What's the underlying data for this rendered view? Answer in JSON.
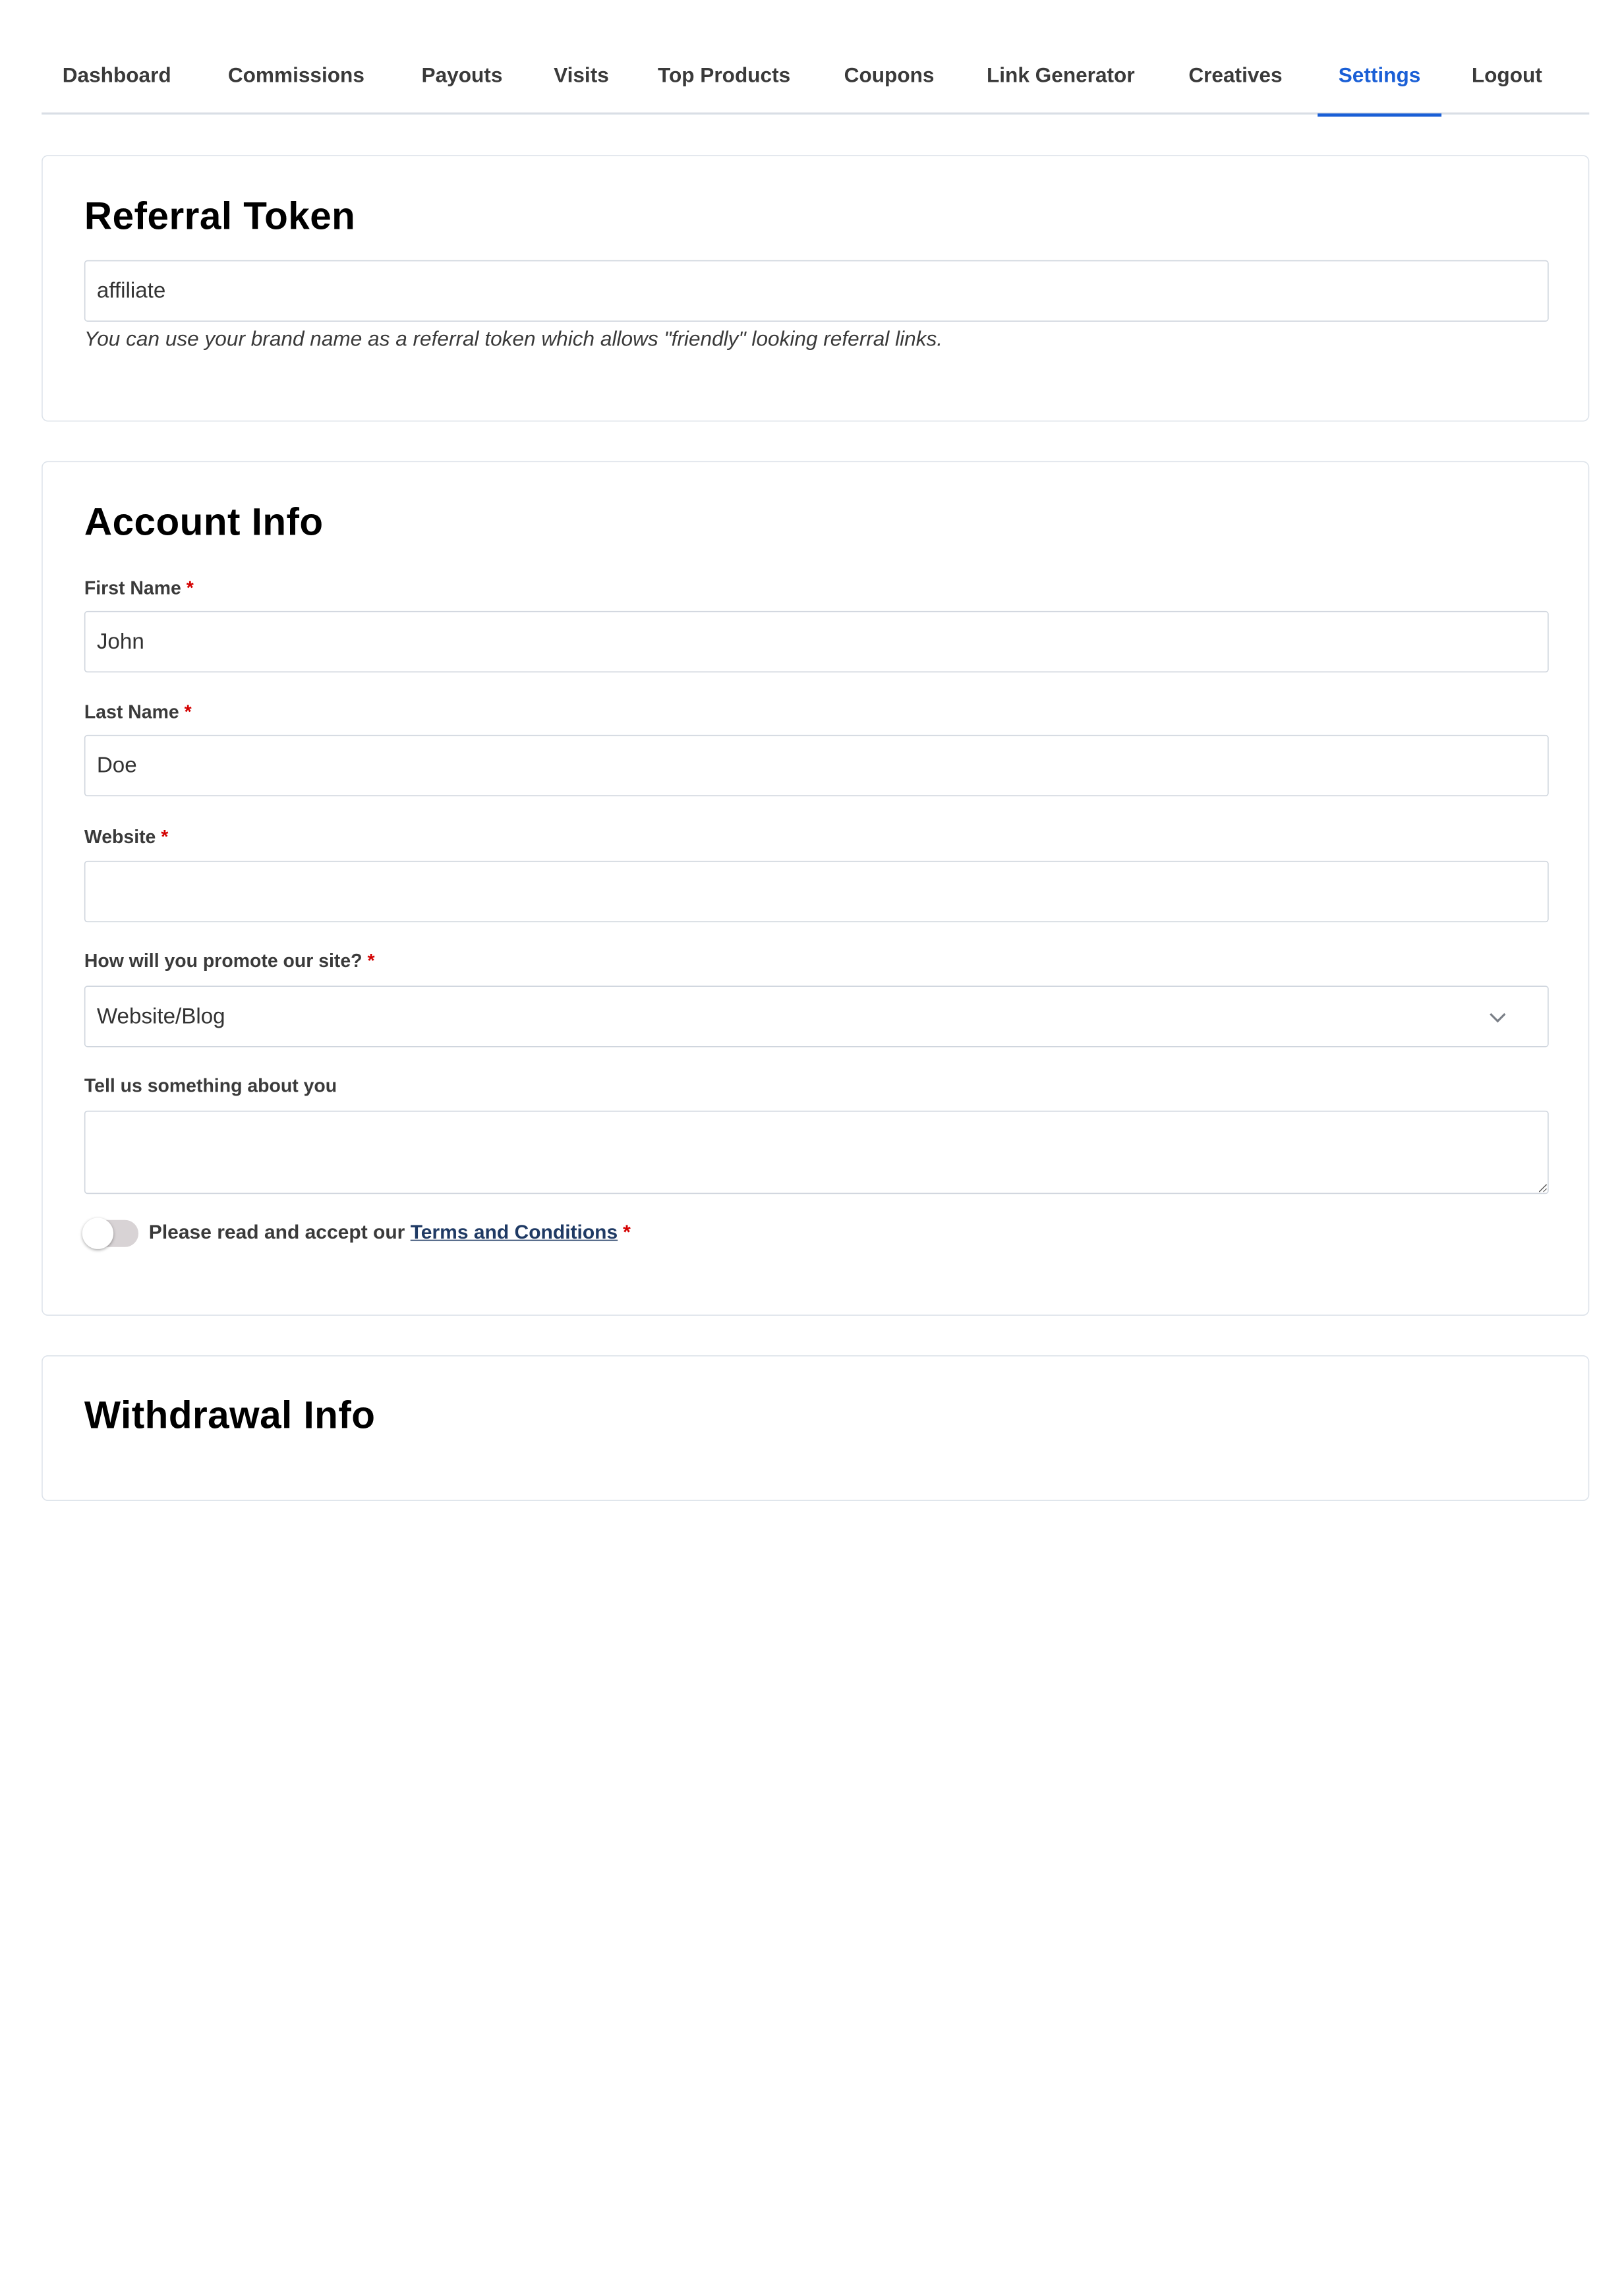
{
  "nav": {
    "tabs": [
      {
        "label": "Dashboard"
      },
      {
        "label": "Commissions"
      },
      {
        "label": "Payouts"
      },
      {
        "label": "Visits"
      },
      {
        "label": "Top Products"
      },
      {
        "label": "Coupons"
      },
      {
        "label": "Link Generator"
      },
      {
        "label": "Creatives"
      },
      {
        "label": "Settings",
        "active": true
      },
      {
        "label": "Logout"
      }
    ]
  },
  "referral": {
    "title": "Referral Token",
    "token_value": "affiliate",
    "help_text": "You can use your brand name as a referral token which allows \"friendly\" looking referral links."
  },
  "account": {
    "title": "Account Info",
    "first_name": {
      "label": "First Name",
      "required_mark": "*",
      "value": "John"
    },
    "last_name": {
      "label": "Last Name",
      "required_mark": "*",
      "value": "Doe"
    },
    "website": {
      "label": "Website",
      "required_mark": "*",
      "value": ""
    },
    "promote": {
      "label": "How will you promote our site?",
      "required_mark": "*",
      "selected": "Website/Blog",
      "icon": "chevron-down-icon"
    },
    "about": {
      "label": "Tell us something about you",
      "value": ""
    },
    "terms": {
      "prefix": "Please read and accept our",
      "link_label": "Terms and Conditions",
      "required_mark": "*",
      "accepted": false
    }
  },
  "withdrawal": {
    "title": "Withdrawal Info"
  },
  "colors": {
    "accent": "#1a5fd6",
    "required": "#d40000",
    "link": "#1f3a64",
    "toggle_off": "#d8d3d5"
  }
}
